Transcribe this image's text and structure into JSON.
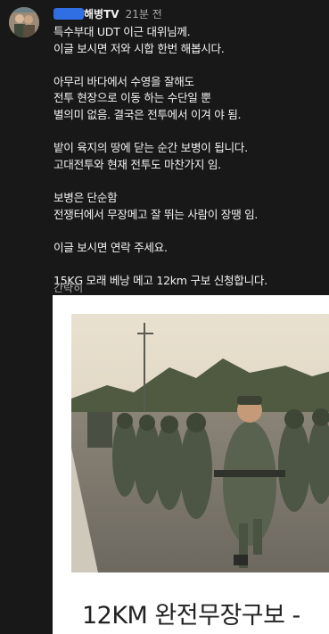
{
  "comment": {
    "author": "해병TV",
    "time": "21분 전",
    "lines": [
      "특수부대 UDT 이근 대위님께.",
      "이글 보시면 저와 시합 한번 해봅시다.",
      "",
      "아무리 바다에서 수영을 잘해도",
      "전투 현장으로 이동 하는 수단일 뿐",
      "별의미 없음. 결국은 전투에서 이겨 야 됨.",
      "",
      "밭이 육지의 땅에 닫는 순간 보병이 됩니다.",
      "고대전투와 현재 전투도 마찬가지 임.",
      "",
      "보병은 단순함",
      "전쟁터에서 무장메고 잘 뛰는 사람이 장땡 임.",
      "",
      "이글 보시면 연락 주세요.",
      "",
      "15KG 모래 베낭 메고 12km 구보 신청합니다."
    ],
    "more_label": "간략히"
  },
  "card": {
    "title": "12KM 완전무장구보 -"
  }
}
